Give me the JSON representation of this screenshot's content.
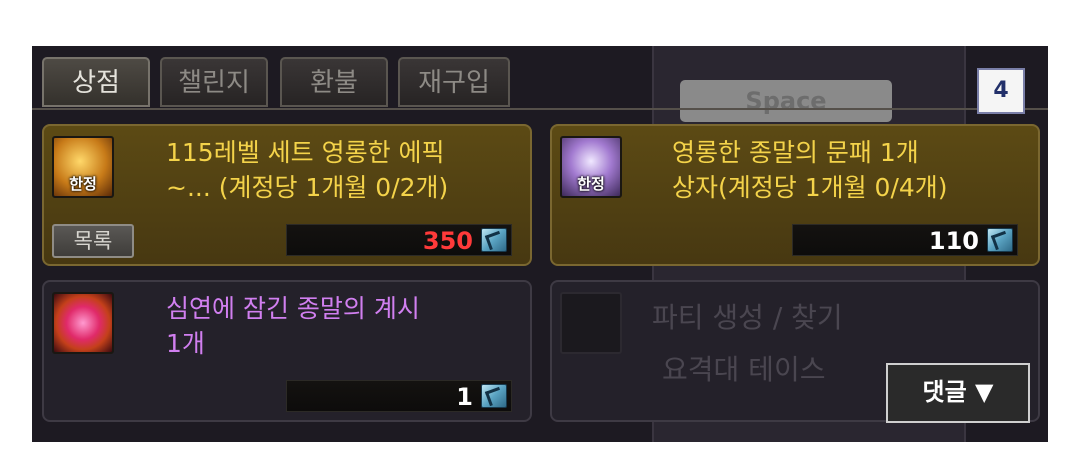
{
  "tabs": [
    {
      "label": "상점",
      "active": true
    },
    {
      "label": "챌린지",
      "active": false
    },
    {
      "label": "환불",
      "active": false
    },
    {
      "label": "재구입",
      "active": false
    }
  ],
  "background": {
    "space_label": "Space",
    "party_line1": "파티 생성 / 찾기",
    "party_line2": "요격대 테이스"
  },
  "page_badge": "4",
  "items": [
    {
      "title_line1": "115레벨 세트 영롱한 에픽",
      "title_line2": "~...  (계정당 1개월 0/2개)",
      "badge": "한정",
      "price": "350",
      "price_color": "#ff3a3a",
      "icon": "gold-chest-icon"
    },
    {
      "title_line1": "영롱한 종말의 문패 1개",
      "title_line2": "상자(계정당 1개월 0/4개)",
      "badge": "한정",
      "price": "110",
      "price_color": "#ffffff",
      "icon": "purple-crest-chest-icon"
    },
    {
      "title_line1": "심연에 잠긴 종말의 계시",
      "title_line2": "1개",
      "badge": "",
      "price": "1",
      "price_color": "#ffffff",
      "icon": "abyss-orb-icon"
    }
  ],
  "list_button": "목록",
  "comment_button": "댓글 ▼",
  "colors": {
    "item_title_gold": "#f4d34a",
    "item_title_purple": "#d17ff0",
    "card_gold_bg": "#4f4012"
  }
}
